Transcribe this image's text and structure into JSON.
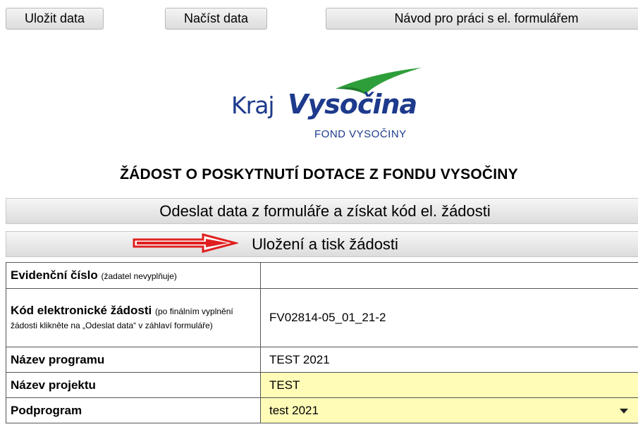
{
  "toolbar": {
    "save_label": "Uložit data",
    "load_label": "Načíst data",
    "guide_label": "Návod pro práci s el. formulářem"
  },
  "logo": {
    "kraj": "Kraj",
    "vysocina": "Vysočina",
    "fond": "FOND VYSOČINY",
    "brand_color": "#1d3a8c",
    "swoosh_color": "#2e9e3a"
  },
  "page_title": "ŽÁDOST O POSKYTNUTÍ DOTACE Z FONDU VYSOČINY",
  "actions": {
    "send_label": "Odeslat data z formuláře a získat kód el. žádosti",
    "save_print_label": "Uložení a tisk žádosti"
  },
  "form": {
    "rows": [
      {
        "label": "Evidenční číslo",
        "hint": "(žadatel nevyplňuje)",
        "value": ""
      },
      {
        "label": "Kód elektronické žádosti",
        "hint": "(po finálním vyplnění žádosti klikněte na „Odeslat data“ v záhlaví formuláře)",
        "value": "FV02814-05_01_21-2"
      },
      {
        "label": "Název programu",
        "hint": "",
        "value": "TEST 2021"
      },
      {
        "label": "Název projektu",
        "hint": "",
        "value": "TEST"
      },
      {
        "label": "Podprogram",
        "hint": "",
        "value": "test 2021"
      }
    ]
  },
  "colors": {
    "highlight": "#fffcb8",
    "arrow": "#e02020"
  }
}
